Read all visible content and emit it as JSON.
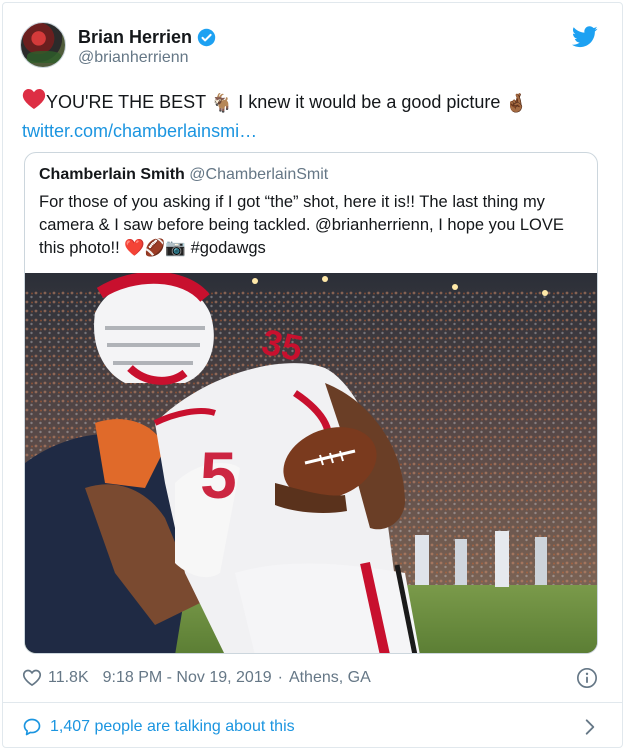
{
  "author": {
    "display_name": "Brian Herrien",
    "handle": "@brianherrienn",
    "verified": true
  },
  "tweet": {
    "emoji_heart": "❤️",
    "text_part1": "YOU'RE THE BEST ",
    "emoji_goat": "🐐",
    "text_part2": " I knew it would be a good picture ",
    "emoji_fingers": "🤞🏾",
    "link": "twitter.com/chamberlainsmi…"
  },
  "quoted_tweet": {
    "display_name": "Chamberlain Smith",
    "handle": "@ChamberlainSmit",
    "text": "For those of you asking if I got “the” shot, here it is!! The last thing my camera & I saw before being tackled. @brianherrienn, I hope you LOVE this photo!!",
    "emojis": "❤️🏈📷",
    "hashtag": "#godawgs",
    "photo_jersey_number": "35"
  },
  "meta": {
    "likes": "11.8K",
    "time": "9:18 PM - Nov 19, 2019",
    "separator": "·",
    "location": "Athens, GA"
  },
  "footer": {
    "talking": "1,407 people are talking about this"
  },
  "colors": {
    "brand_blue": "#1da1f2",
    "link_blue": "#1b95e0",
    "heart_red": "#e0245e",
    "muted_gray": "#657786"
  }
}
